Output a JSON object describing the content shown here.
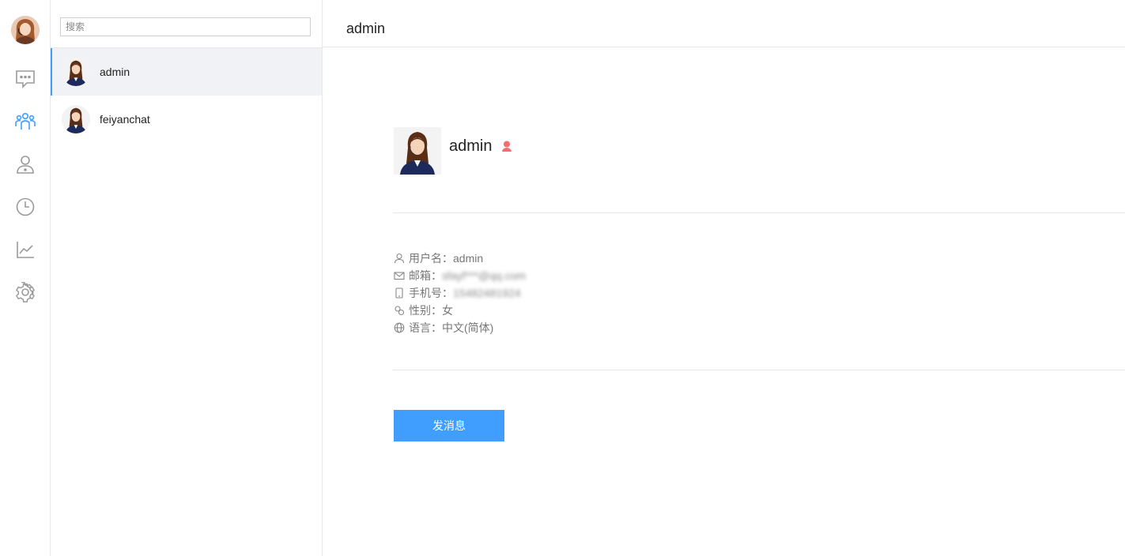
{
  "me": {
    "avatar_icon": "user-avatar-icon"
  },
  "rail": {
    "items": [
      {
        "icon": "chat-icon",
        "active": false
      },
      {
        "icon": "contacts-icon",
        "active": true
      },
      {
        "icon": "user-icon",
        "active": false
      },
      {
        "icon": "clock-icon",
        "active": false
      },
      {
        "icon": "chart-icon",
        "active": false
      },
      {
        "icon": "gear-icon",
        "active": false
      }
    ]
  },
  "search": {
    "placeholder": "搜索"
  },
  "contacts": [
    {
      "name": "admin",
      "active": true
    },
    {
      "name": "feiyanchat",
      "active": false
    }
  ],
  "header": {
    "title": "admin"
  },
  "profile": {
    "name": "admin",
    "gender_icon": "female-icon",
    "rows": [
      {
        "icon": "user-icon",
        "label": "用户名：",
        "value": "admin",
        "blurred": false
      },
      {
        "icon": "mail-icon",
        "label": "邮箱：",
        "value": "sfayf***@qq.com",
        "blurred": true
      },
      {
        "icon": "phone-icon",
        "label": "手机号：",
        "value": "15482481924",
        "blurred": true
      },
      {
        "icon": "gender-icon",
        "label": "性别：",
        "value": "女",
        "blurred": false
      },
      {
        "icon": "globe-icon",
        "label": "语言：",
        "value": "中文(简体)",
        "blurred": false
      }
    ],
    "send_label": "发消息"
  },
  "colors": {
    "accent": "#409eff",
    "female": "#f56c6c",
    "icon_gray": "#9a9a9a"
  }
}
